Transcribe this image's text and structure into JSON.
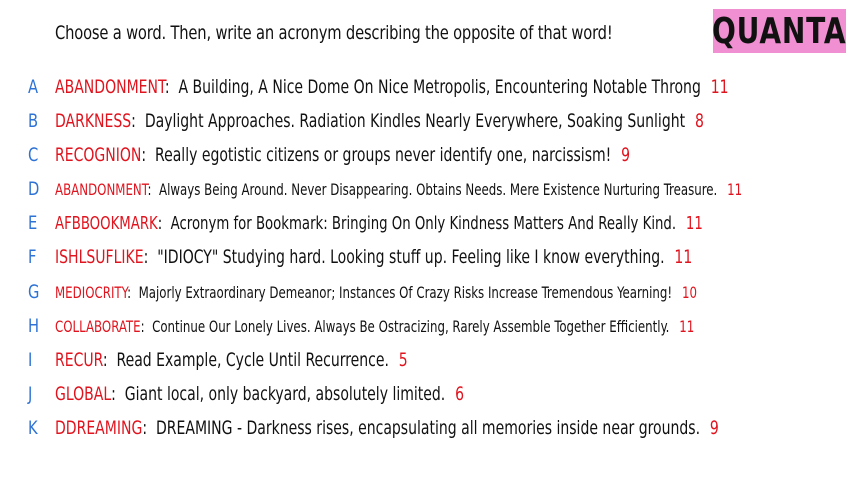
{
  "prompt": "Choose a word. Then, write an acronym describing the opposite of that word!",
  "logo": "QUANTA",
  "entries": [
    {
      "letter": "A",
      "word": "ABANDONMENT",
      "acronym": "A Building, A Nice Dome On Nice Metropolis, Encountering Notable Throng",
      "count": "11"
    },
    {
      "letter": "B",
      "word": "DARKNESS",
      "acronym": "Daylight Approaches. Radiation Kindles Nearly Everywhere, Soaking Sunlight",
      "count": "8"
    },
    {
      "letter": "C",
      "word": "RECOGNION",
      "acronym": "Really egotistic citizens or groups never identify one, narcissism!",
      "count": "9"
    },
    {
      "letter": "D",
      "word": "ABANDONMENT",
      "acronym": "Always Being Around. Never Disappearing. Obtains Needs. Mere Existence Nurturing Treasure.",
      "count": "11"
    },
    {
      "letter": "E",
      "word": "AFBBOOKMARK",
      "acronym": "Acronym for Bookmark: Bringing On Only Kindness Matters And Really Kind.",
      "count": "11"
    },
    {
      "letter": "F",
      "word": "ISHLSUFLIKE",
      "acronym": "\"IDIOCY\" Studying hard. Looking stuff up. Feeling like I know everything.",
      "count": "11"
    },
    {
      "letter": "G",
      "word": "MEDIOCRITY",
      "acronym": "Majorly Extraordinary Demeanor; Instances Of Crazy Risks Increase Tremendous Yearning!",
      "count": "10"
    },
    {
      "letter": "H",
      "word": "COLLABORATE",
      "acronym": "Continue Our Lonely Lives. Always Be Ostracizing, Rarely Assemble Together Efficiently.",
      "count": "11"
    },
    {
      "letter": "I",
      "word": "RECUR",
      "acronym": "Read Example, Cycle Until Recurrence.",
      "count": "5"
    },
    {
      "letter": "J",
      "word": "GLOBAL",
      "acronym": "Giant local, only backyard, absolutely limited.",
      "count": "6"
    },
    {
      "letter": "K",
      "word": "DDREAMING",
      "acronym": "DREAMING - Darkness rises, encapsulating all memories inside near grounds.",
      "count": "9"
    }
  ]
}
